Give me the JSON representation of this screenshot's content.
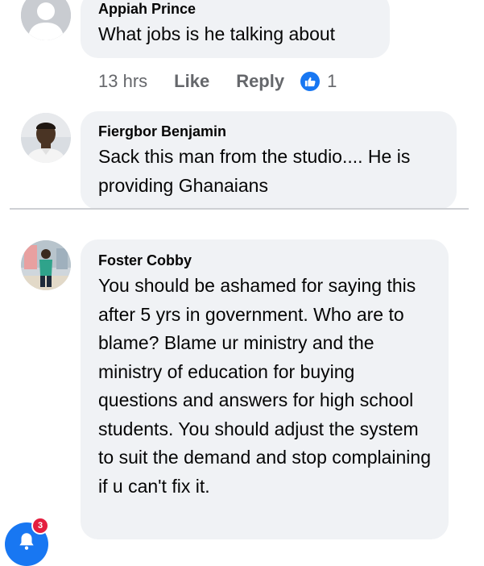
{
  "comments": [
    {
      "author": "Appiah Prince",
      "text": "What jobs is he talking about",
      "avatar_icon": "default-profile-icon",
      "meta": {
        "time": "13 hrs",
        "like_label": "Like",
        "reply_label": "Reply",
        "reaction_icon": "like-thumb-icon",
        "reaction_count": "1"
      }
    },
    {
      "author": "Fiergbor Benjamin",
      "text": "Sack this man from the studio.... He is providing Ghanaians",
      "avatar_icon": "user-photo"
    },
    {
      "author": "Foster Cobby",
      "text": "You should be ashamed for saying this after 5 yrs in government. Who are to blame? Blame ur ministry and the ministry of education for buying questions and answers for high school students. You should adjust the system to suit the demand and stop complaining if u can't fix it.",
      "avatar_icon": "user-photo"
    }
  ],
  "notifications": {
    "icon": "bell-icon",
    "badge_count": "3"
  },
  "colors": {
    "bubble": "#f0f2f5",
    "muted_text": "#65676b",
    "accent": "#1877f2",
    "badge": "#e41e3f"
  }
}
